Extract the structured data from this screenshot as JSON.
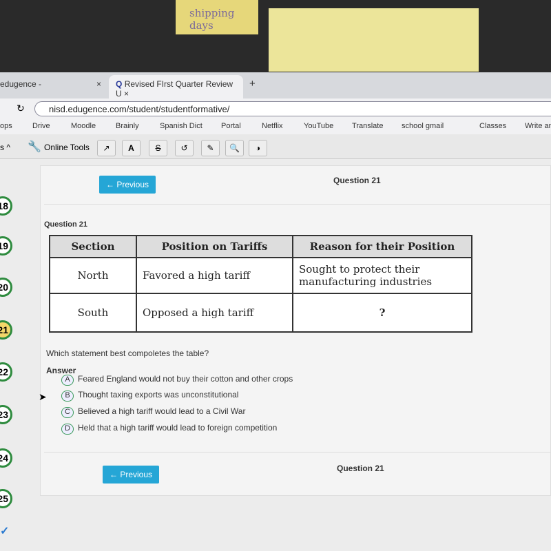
{
  "background": {
    "sticky_note_text": "shipping days"
  },
  "browser": {
    "tabs": [
      {
        "title": "edugence -"
      },
      {
        "title": "Revised FIrst Quarter Review U"
      }
    ],
    "new_tab": "+",
    "close": "×",
    "url": "nisd.edugence.com/student/studentformative/",
    "bookmarks": [
      "ops",
      "Drive",
      "Moodle",
      "Brainly",
      "Spanish Dict",
      "Portal",
      "Netflix",
      "YouTube",
      "Translate",
      "school gmail",
      "Classes",
      "Write an"
    ]
  },
  "toolbar": {
    "collapse": "s ^",
    "label": "Online Tools",
    "buttons": [
      "↗",
      "A",
      "S",
      "↺",
      "✎",
      "🔍",
      "◑"
    ]
  },
  "sidebar": {
    "questions": [
      "18",
      "19",
      "20",
      "21",
      "22",
      "23",
      "24",
      "25",
      "✓"
    ],
    "current": "21"
  },
  "nav": {
    "previous": "← Previous",
    "question_label": "Question 21"
  },
  "question": {
    "title": "Question 21",
    "table": {
      "headers": [
        "Section",
        "Position on Tariffs",
        "Reason for their Position"
      ],
      "rows": [
        [
          "North",
          "Favored a high tariff",
          "Sought to protect their manufacturing industries"
        ],
        [
          "South",
          "Opposed a high tariff",
          "?"
        ]
      ]
    },
    "stem": "Which statement best compoletes the table?",
    "answer_label": "Answer",
    "options": [
      {
        "letter": "A",
        "text": "Feared England would not buy their cotton and other crops"
      },
      {
        "letter": "B",
        "text": "Thought taxing exports was unconstitutional"
      },
      {
        "letter": "C",
        "text": "Believed a high tariff would lead to a Civil War"
      },
      {
        "letter": "D",
        "text": "Held that a high tariff would lead to foreign competition"
      }
    ]
  }
}
